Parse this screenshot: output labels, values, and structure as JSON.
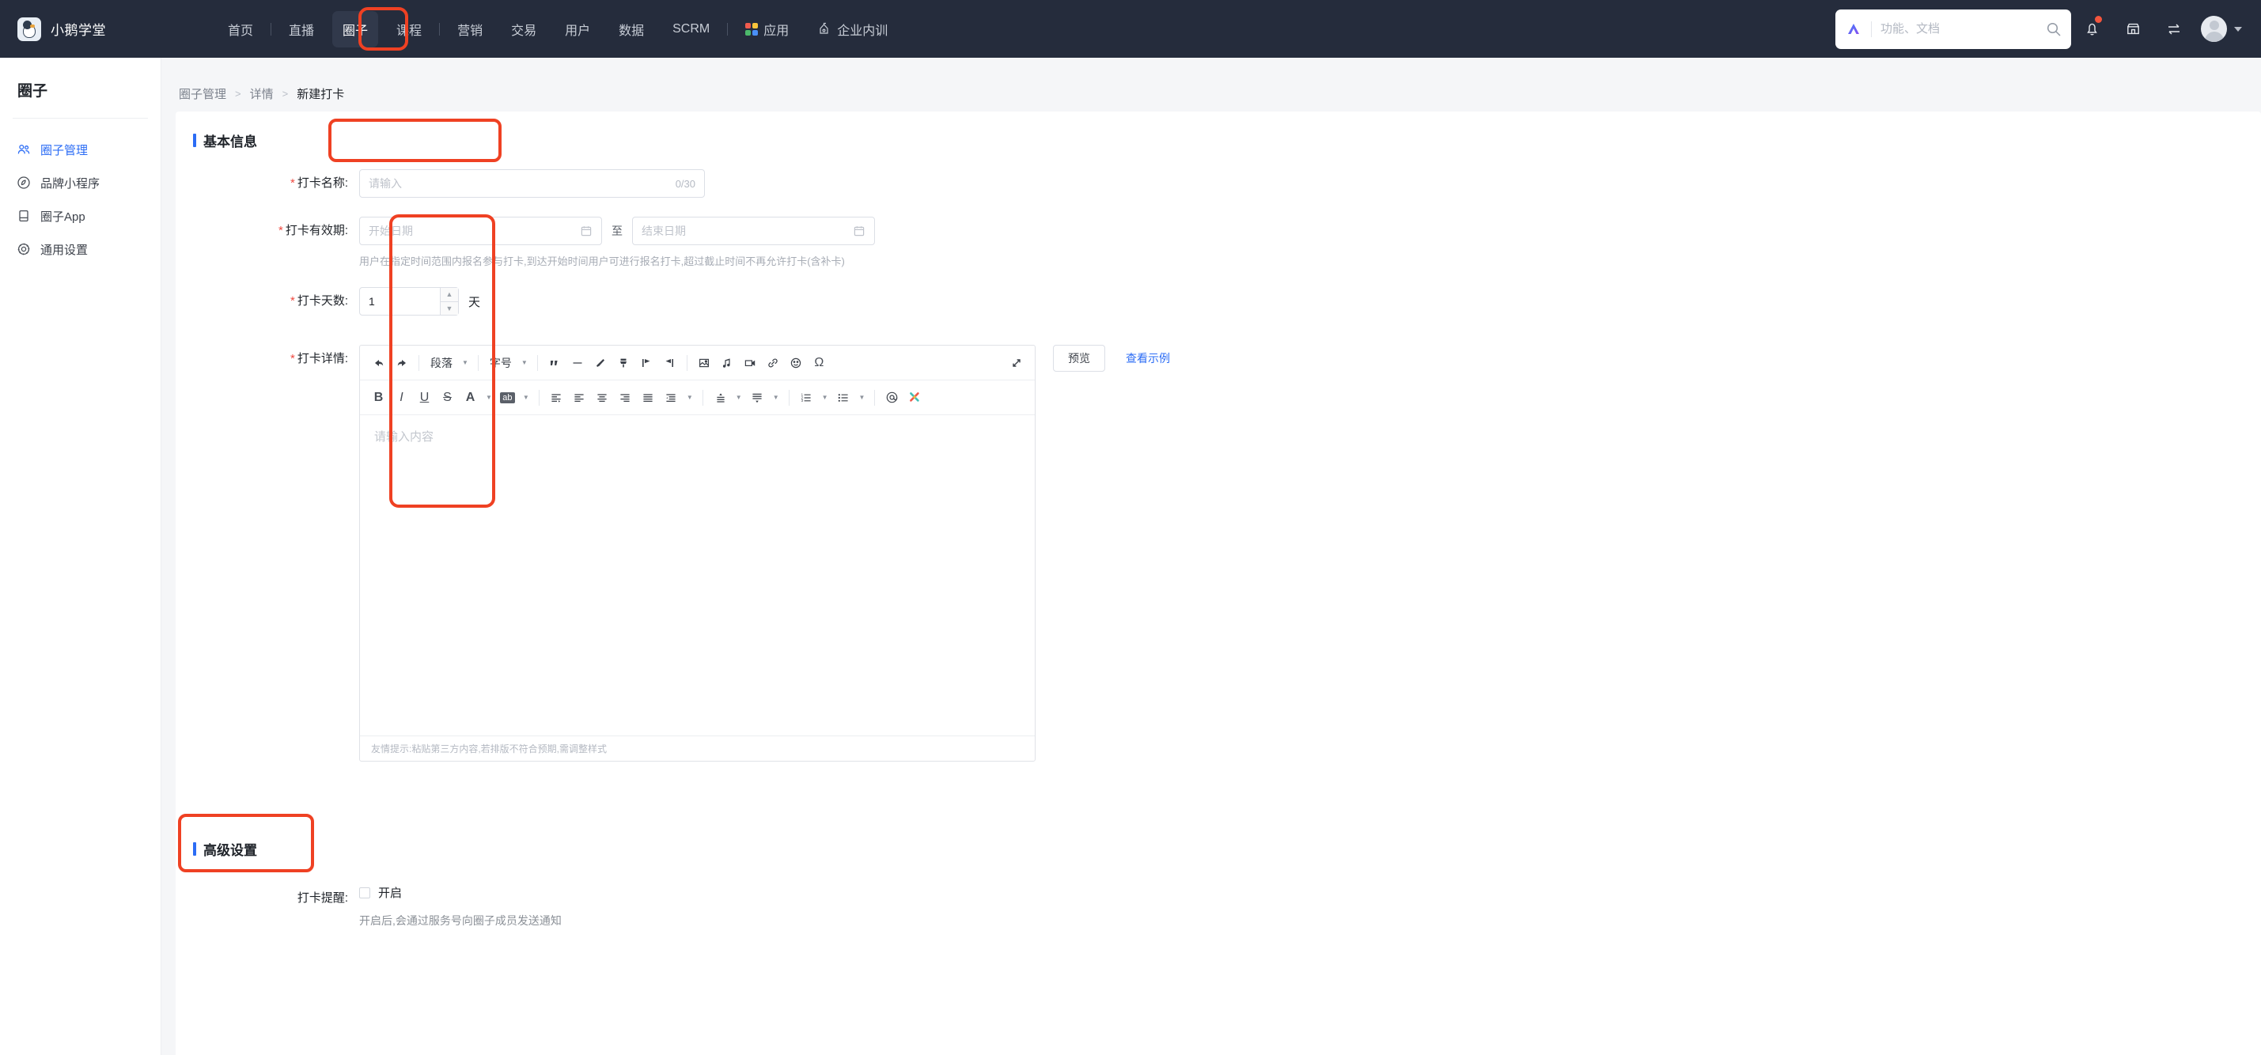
{
  "topnav": {
    "brand": "小鹅学堂",
    "brand_logo_icon": "goose-logo-icon",
    "items": [
      {
        "label": "首页",
        "active": false,
        "sep_after": true
      },
      {
        "label": "直播",
        "active": false,
        "sep_after": false
      },
      {
        "label": "圈子",
        "active": true,
        "sep_after": false
      },
      {
        "label": "课程",
        "active": false,
        "sep_after": true
      },
      {
        "label": "营销",
        "active": false,
        "sep_after": false
      },
      {
        "label": "交易",
        "active": false,
        "sep_after": false
      },
      {
        "label": "用户",
        "active": false,
        "sep_after": false
      },
      {
        "label": "数据",
        "active": false,
        "sep_after": false
      },
      {
        "label": "SCRM",
        "active": false,
        "sep_after": true
      }
    ],
    "apps_label": "应用",
    "apps_icon": "apps-grid-icon",
    "training_label": "企业内训",
    "training_icon": "enterprise-training-icon",
    "search_placeholder": "功能、文档",
    "search_value": "",
    "search_icon": "search-icon",
    "ai_icon": "ai-assistant-icon",
    "bell_icon": "bell-icon",
    "shop_icon": "shop-icon",
    "switch_icon": "switch-account-icon",
    "avatar_icon": "avatar",
    "caret_icon": "chevron-down-icon"
  },
  "sidebar": {
    "title": "圈子",
    "items": [
      {
        "label": "圈子管理",
        "icon": "users-group-icon",
        "active": true
      },
      {
        "label": "品牌小程序",
        "icon": "miniprogram-icon",
        "active": false
      },
      {
        "label": "圈子App",
        "icon": "mobile-app-icon",
        "active": false
      },
      {
        "label": "通用设置",
        "icon": "gear-icon",
        "active": false
      }
    ]
  },
  "breadcrumb": {
    "items": [
      "圈子管理",
      "详情",
      "新建打卡"
    ],
    "separator": ">"
  },
  "basic": {
    "section_title": "基本信息",
    "name_label": "打卡名称:",
    "name_placeholder": "请输入",
    "name_value": "",
    "name_counter": "0/30",
    "period_label": "打卡有效期:",
    "date_start_placeholder": "开始日期",
    "date_start_value": "",
    "date_end_placeholder": "结束日期",
    "date_end_value": "",
    "date_sep": "至",
    "calendar_icon": "calendar-icon",
    "period_hint": "用户在指定时间范围内报名参与打卡,到达开始时间用户可进行报名打卡,超过截止时间不再允许打卡(含补卡)",
    "days_label": "打卡天数:",
    "days_value": "1",
    "days_unit": "天",
    "detail_label": "打卡详情:",
    "required_mark": "*"
  },
  "editor": {
    "toolbar_row1": [
      {
        "name": "undo-icon",
        "glyph": "↰",
        "type": "icon"
      },
      {
        "name": "redo-icon",
        "glyph": "↱",
        "type": "icon"
      },
      {
        "name": "separator",
        "type": "sep"
      },
      {
        "name": "paragraph-style-dropdown",
        "glyph": "段落",
        "type": "label"
      },
      {
        "name": "separator",
        "type": "sep"
      },
      {
        "name": "font-size-dropdown",
        "glyph": "字号",
        "type": "label"
      },
      {
        "name": "separator",
        "type": "sep"
      },
      {
        "name": "blockquote-icon",
        "glyph": "❞",
        "type": "icon"
      },
      {
        "name": "horizontal-rule-icon",
        "glyph": "—",
        "type": "icon"
      },
      {
        "name": "eraser-icon",
        "glyph": "◣",
        "type": "icon"
      },
      {
        "name": "format-painter-icon",
        "glyph": "🖌",
        "type": "icon"
      },
      {
        "name": "insert-before-icon",
        "glyph": "▶|",
        "type": "icon"
      },
      {
        "name": "insert-after-icon",
        "glyph": "|◀",
        "type": "icon"
      },
      {
        "name": "separator",
        "type": "sep"
      },
      {
        "name": "image-icon",
        "glyph": "🖼",
        "type": "icon"
      },
      {
        "name": "audio-icon",
        "glyph": "♫",
        "type": "icon"
      },
      {
        "name": "video-icon",
        "glyph": "▭",
        "type": "icon"
      },
      {
        "name": "link-icon",
        "glyph": "🔗",
        "type": "icon"
      },
      {
        "name": "emoji-icon",
        "glyph": "☺",
        "type": "icon"
      },
      {
        "name": "special-character-icon",
        "glyph": "Ω",
        "type": "icon"
      },
      {
        "name": "spacer",
        "type": "spacer"
      },
      {
        "name": "fullscreen-icon",
        "glyph": "⤢",
        "type": "icon"
      }
    ],
    "toolbar_row2": [
      {
        "name": "bold-icon",
        "glyph": "B",
        "type": "icon"
      },
      {
        "name": "italic-icon",
        "glyph": "I",
        "type": "icon"
      },
      {
        "name": "underline-icon",
        "glyph": "U",
        "type": "icon"
      },
      {
        "name": "strikethrough-icon",
        "glyph": "S",
        "type": "icon"
      },
      {
        "name": "font-color-icon",
        "glyph": "A",
        "type": "icon-dd"
      },
      {
        "name": "background-color-icon",
        "glyph": "ab",
        "type": "icon-dd"
      },
      {
        "name": "separator",
        "type": "sep"
      },
      {
        "name": "indent-icon",
        "glyph": "⇥",
        "type": "icon"
      },
      {
        "name": "align-left-icon",
        "glyph": "≡",
        "type": "icon"
      },
      {
        "name": "align-center-icon",
        "glyph": "≡",
        "type": "icon"
      },
      {
        "name": "align-right-icon",
        "glyph": "≡",
        "type": "icon"
      },
      {
        "name": "align-justify-icon",
        "glyph": "≡",
        "type": "icon"
      },
      {
        "name": "indent-options-icon",
        "glyph": "≡",
        "type": "icon-dd"
      },
      {
        "name": "separator",
        "type": "sep"
      },
      {
        "name": "line-height-icon",
        "glyph": "↕",
        "type": "icon-dd"
      },
      {
        "name": "paragraph-spacing-icon",
        "glyph": "↧",
        "type": "icon-dd"
      },
      {
        "name": "separator",
        "type": "sep"
      },
      {
        "name": "ordered-list-icon",
        "glyph": "⒈",
        "type": "icon-dd"
      },
      {
        "name": "unordered-list-icon",
        "glyph": "•",
        "type": "icon-dd"
      },
      {
        "name": "separator",
        "type": "sep"
      },
      {
        "name": "mention-icon",
        "glyph": "@",
        "type": "icon"
      },
      {
        "name": "clear-format-icon",
        "glyph": "✂",
        "type": "icon"
      }
    ],
    "body_placeholder": "请输入内容",
    "body_value": "",
    "footer_tip": "友情提示:粘贴第三方内容,若排版不符合预期,需调整样式",
    "preview_label": "预览",
    "example_link": "查看示例"
  },
  "advanced": {
    "section_title": "高级设置",
    "remind_label": "打卡提醒:",
    "remind_checkbox_label": "开启",
    "remind_checked": false,
    "remind_hint": "开启后,会通过服务号向圈子成员发送通知"
  },
  "colors": {
    "nav_bg": "#252c3c",
    "accent_blue": "#2b6cf5",
    "highlight_red": "#ef4123",
    "required_red": "#ef4a41",
    "page_bg": "#f5f6f8"
  }
}
